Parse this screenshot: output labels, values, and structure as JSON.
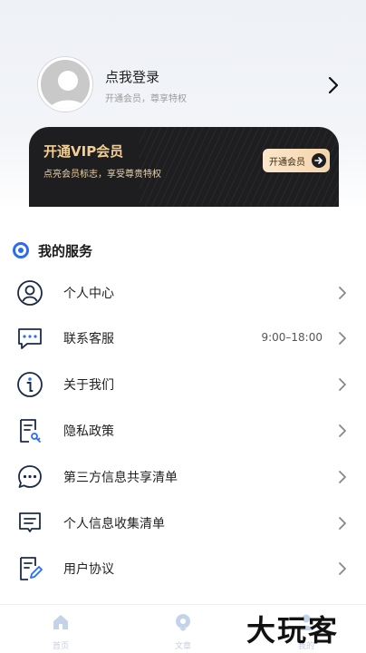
{
  "profile": {
    "login_title": "点我登录",
    "login_subtitle": "开通会员，尊享特权"
  },
  "vip": {
    "title": "开通VIP会员",
    "subtitle": "点亮会员标志，享受尊贵特权",
    "button_label": "开通会员",
    "colors": {
      "card": "#1e1e20",
      "gold": "#f3cf94"
    }
  },
  "services": {
    "title": "我的服务",
    "items": [
      {
        "label": "个人中心",
        "value": "",
        "icon": "user-icon"
      },
      {
        "label": "联系客服",
        "value": "9:00–18:00",
        "icon": "chat-icon"
      },
      {
        "label": "关于我们",
        "value": "",
        "icon": "info-icon"
      },
      {
        "label": "隐私政策",
        "value": "",
        "icon": "document-key-icon"
      },
      {
        "label": "第三方信息共享清单",
        "value": "",
        "icon": "chat-dots-icon"
      },
      {
        "label": "个人信息收集清单",
        "value": "",
        "icon": "message-list-icon"
      },
      {
        "label": "用户协议",
        "value": "",
        "icon": "document-edit-icon"
      }
    ]
  },
  "tabbar": {
    "tabs": [
      {
        "label": "首页",
        "icon": "home-icon"
      },
      {
        "label": "文章",
        "icon": "article-icon"
      },
      {
        "label": "我的",
        "icon": "profile-icon"
      }
    ]
  },
  "watermark": "大玩客",
  "accent_color": "#2b6cf6"
}
